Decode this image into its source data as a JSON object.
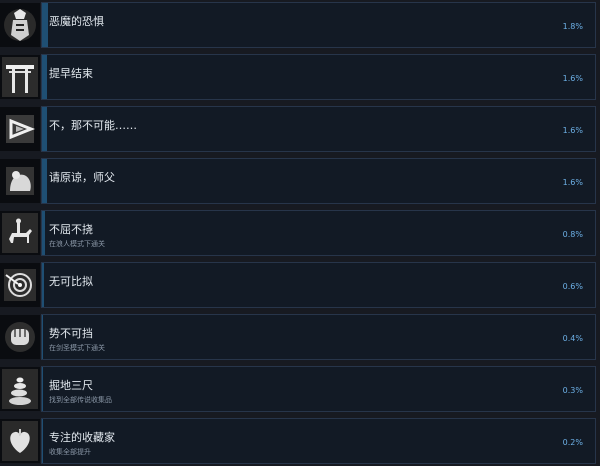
{
  "achievements": [
    {
      "icon": "samurai-armor-icon",
      "title": "恶魔的恐惧",
      "description": "",
      "percent_label": "1.8%",
      "percent": 1.8
    },
    {
      "icon": "torii-gate-icon",
      "title": "提早结束",
      "description": "",
      "percent_label": "1.6%",
      "percent": 1.6
    },
    {
      "icon": "triangle-symbol-icon",
      "title": "不，那不可能……",
      "description": "",
      "percent_label": "1.6%",
      "percent": 1.6
    },
    {
      "icon": "kneeling-figure-icon",
      "title": "请原谅，师父",
      "description": "",
      "percent_label": "1.6%",
      "percent": 1.6
    },
    {
      "icon": "horse-rider-icon",
      "title": "不屈不挠",
      "description": "在浪人模式下通关",
      "percent_label": "0.8%",
      "percent": 0.8
    },
    {
      "icon": "arrow-target-icon",
      "title": "无可比拟",
      "description": "",
      "percent_label": "0.6%",
      "percent": 0.6
    },
    {
      "icon": "fist-icon",
      "title": "势不可挡",
      "description": "在剑圣模式下通关",
      "percent_label": "0.4%",
      "percent": 0.4
    },
    {
      "icon": "stone-stack-icon",
      "title": "掘地三尺",
      "description": "找到全部传说收集品",
      "percent_label": "0.3%",
      "percent": 0.3
    },
    {
      "icon": "heart-icon",
      "title": "专注的收藏家",
      "description": "收集全部提升",
      "percent_label": "0.2%",
      "percent": 0.2
    }
  ],
  "colors": {
    "background": "#171a21",
    "panel": "#121a25",
    "bar": "#1f4f73",
    "percent_text": "#6db0e6"
  }
}
